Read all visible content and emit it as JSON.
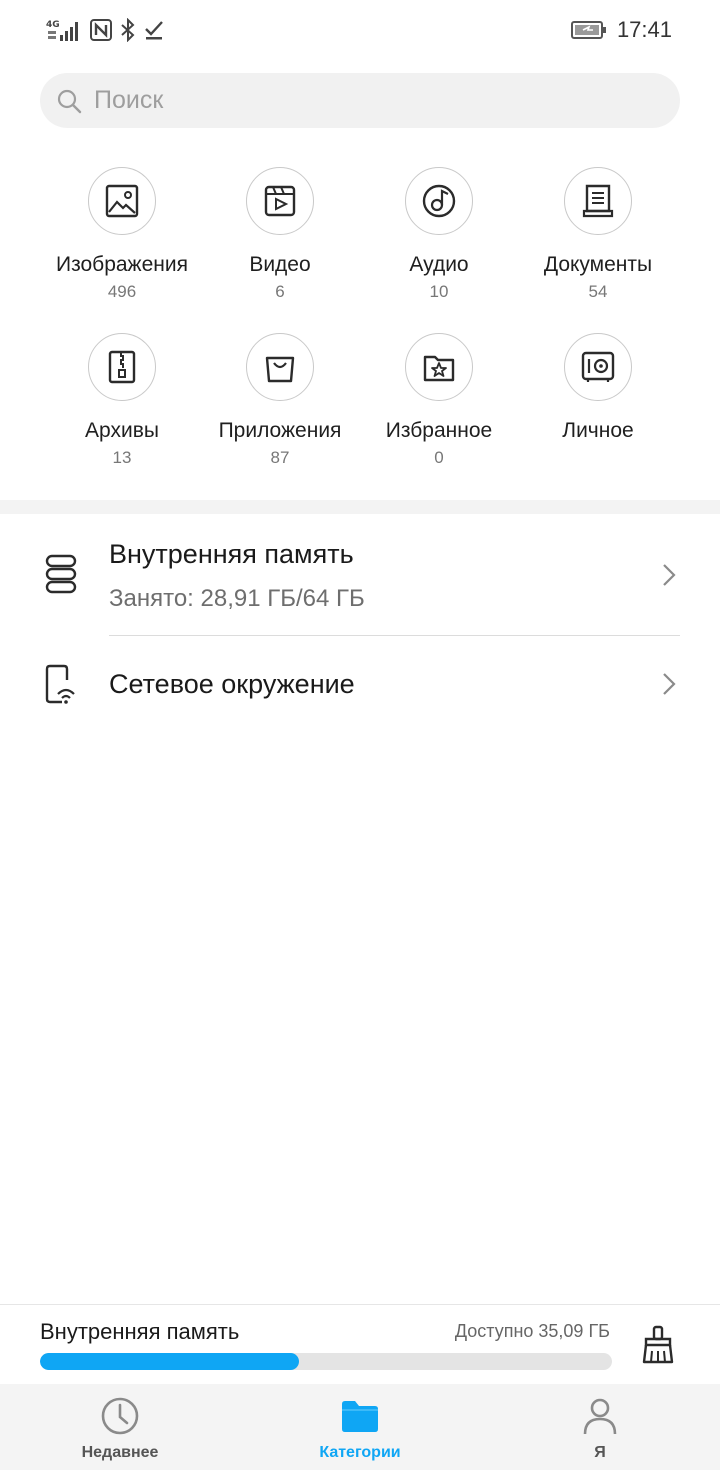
{
  "status_bar": {
    "network": "4G",
    "time": "17:41"
  },
  "search": {
    "placeholder": "Поиск",
    "value": ""
  },
  "categories": [
    {
      "label": "Изображения",
      "count": "496",
      "icon": "image-icon"
    },
    {
      "label": "Видео",
      "count": "6",
      "icon": "video-icon"
    },
    {
      "label": "Аудио",
      "count": "10",
      "icon": "audio-icon"
    },
    {
      "label": "Документы",
      "count": "54",
      "icon": "document-icon"
    },
    {
      "label": "Архивы",
      "count": "13",
      "icon": "archive-icon"
    },
    {
      "label": "Приложения",
      "count": "87",
      "icon": "app-bag-icon"
    },
    {
      "label": "Избранное",
      "count": "0",
      "icon": "favorites-star-icon"
    },
    {
      "label": "Личное",
      "count": "",
      "icon": "safe-icon"
    }
  ],
  "storage_list": {
    "internal": {
      "title": "Внутренняя память",
      "subtitle": "Занято: 28,91 ГБ/64 ГБ"
    },
    "network": {
      "title": "Сетевое окружение"
    }
  },
  "storage_summary": {
    "title": "Внутренняя память",
    "available": "Доступно 35,09 ГБ",
    "used_fraction": 0.452
  },
  "bottom_nav": {
    "items": [
      {
        "label": "Недавнее",
        "icon": "clock-icon",
        "active": false
      },
      {
        "label": "Категории",
        "icon": "folder-icon",
        "active": true
      },
      {
        "label": "Я",
        "icon": "person-icon",
        "active": false
      }
    ]
  },
  "colors": {
    "accent": "#0fa6f4",
    "icon_stroke": "#2b2b2b"
  }
}
